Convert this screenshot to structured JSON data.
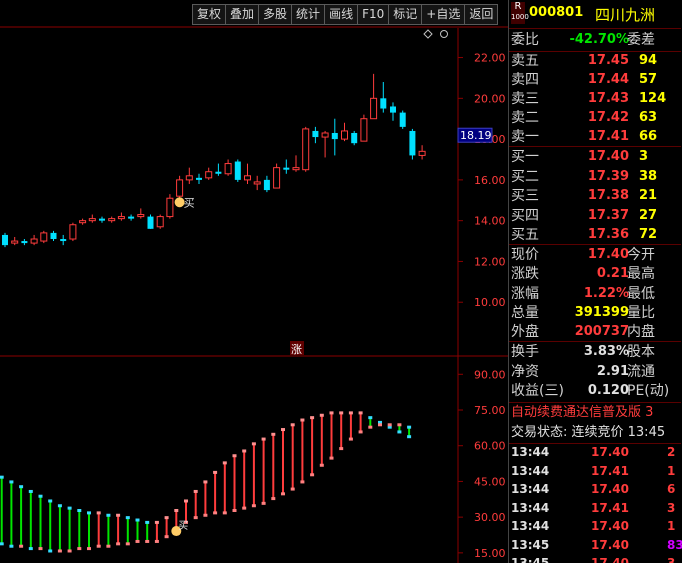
{
  "toolbar": {
    "buttons": [
      "复权",
      "叠加",
      "多股",
      "统计",
      "画线",
      "F10",
      "标记",
      "+自选",
      "返回"
    ]
  },
  "main_chart": {
    "y_ticks": [
      "22.00",
      "20.00",
      "18.00",
      "16.00",
      "14.00",
      "12.00",
      "10.00"
    ],
    "y_tick_values": [
      22,
      20,
      18,
      16,
      14,
      12,
      10
    ],
    "y_range": [
      8.0,
      23.4
    ],
    "current_price_tag": "18.19",
    "current_price_value": 18.19,
    "buy_signal": "买",
    "zhang_marker": "涨",
    "colors": {
      "up": "#ff3c3c",
      "down": "#00e0ff",
      "flat": "#ffffff"
    }
  },
  "chart_data": [
    {
      "type": "candlestick",
      "title": "",
      "ylim": [
        8.0,
        23.4
      ],
      "y_ticks": [
        22,
        20,
        18,
        16,
        14,
        12,
        10
      ],
      "candles": [
        {
          "o": 13.3,
          "c": 12.8,
          "h": 13.4,
          "l": 12.7
        },
        {
          "o": 12.9,
          "c": 13.0,
          "h": 13.2,
          "l": 12.8
        },
        {
          "o": 13.0,
          "c": 12.9,
          "h": 13.1,
          "l": 12.8
        },
        {
          "o": 12.9,
          "c": 13.1,
          "h": 13.3,
          "l": 12.8
        },
        {
          "o": 13.0,
          "c": 13.4,
          "h": 13.5,
          "l": 12.9
        },
        {
          "o": 13.4,
          "c": 13.1,
          "h": 13.5,
          "l": 13.0
        },
        {
          "o": 13.1,
          "c": 13.0,
          "h": 13.3,
          "l": 12.8
        },
        {
          "o": 13.1,
          "c": 13.8,
          "h": 13.9,
          "l": 13.0
        },
        {
          "o": 13.9,
          "c": 14.0,
          "h": 14.1,
          "l": 13.8
        },
        {
          "o": 14.0,
          "c": 14.1,
          "h": 14.3,
          "l": 13.9
        },
        {
          "o": 14.1,
          "c": 14.0,
          "h": 14.2,
          "l": 13.9
        },
        {
          "o": 14.0,
          "c": 14.1,
          "h": 14.2,
          "l": 13.9
        },
        {
          "o": 14.1,
          "c": 14.2,
          "h": 14.4,
          "l": 14.0
        },
        {
          "o": 14.2,
          "c": 14.1,
          "h": 14.3,
          "l": 14.0
        },
        {
          "o": 14.2,
          "c": 14.3,
          "h": 14.6,
          "l": 14.1
        },
        {
          "o": 14.2,
          "c": 13.6,
          "h": 14.3,
          "l": 13.6
        },
        {
          "o": 13.7,
          "c": 14.2,
          "h": 14.3,
          "l": 13.6
        },
        {
          "o": 14.2,
          "c": 15.1,
          "h": 15.3,
          "l": 14.1
        },
        {
          "o": 15.2,
          "c": 16.0,
          "h": 16.2,
          "l": 15.0
        },
        {
          "o": 16.0,
          "c": 16.2,
          "h": 16.6,
          "l": 15.8
        },
        {
          "o": 16.1,
          "c": 16.0,
          "h": 16.3,
          "l": 15.8
        },
        {
          "o": 16.1,
          "c": 16.4,
          "h": 16.6,
          "l": 16.0
        },
        {
          "o": 16.4,
          "c": 16.3,
          "h": 16.8,
          "l": 16.2
        },
        {
          "o": 16.3,
          "c": 16.8,
          "h": 17.0,
          "l": 16.2
        },
        {
          "o": 16.9,
          "c": 16.0,
          "h": 17.0,
          "l": 15.9
        },
        {
          "o": 16.0,
          "c": 16.2,
          "h": 16.8,
          "l": 15.8
        },
        {
          "o": 15.8,
          "c": 15.9,
          "h": 16.2,
          "l": 15.5
        },
        {
          "o": 16.0,
          "c": 15.5,
          "h": 16.2,
          "l": 15.4
        },
        {
          "o": 15.6,
          "c": 16.6,
          "h": 16.8,
          "l": 15.6
        },
        {
          "o": 16.6,
          "c": 16.5,
          "h": 17.0,
          "l": 16.3
        },
        {
          "o": 16.5,
          "c": 16.6,
          "h": 17.2,
          "l": 16.4
        },
        {
          "o": 16.5,
          "c": 18.5,
          "h": 18.6,
          "l": 16.4
        },
        {
          "o": 18.4,
          "c": 18.1,
          "h": 18.6,
          "l": 17.8
        },
        {
          "o": 18.1,
          "c": 18.3,
          "h": 18.4,
          "l": 17.1
        },
        {
          "o": 18.3,
          "c": 18.0,
          "h": 19.0,
          "l": 17.2
        },
        {
          "o": 18.0,
          "c": 18.4,
          "h": 18.8,
          "l": 17.9
        },
        {
          "o": 18.3,
          "c": 17.8,
          "h": 18.4,
          "l": 17.7
        },
        {
          "o": 17.9,
          "c": 19.0,
          "h": 19.2,
          "l": 17.9
        },
        {
          "o": 19.0,
          "c": 20.0,
          "h": 21.2,
          "l": 19.0
        },
        {
          "o": 20.0,
          "c": 19.5,
          "h": 20.8,
          "l": 19.3
        },
        {
          "o": 19.6,
          "c": 19.3,
          "h": 19.8,
          "l": 18.9
        },
        {
          "o": 19.3,
          "c": 18.6,
          "h": 19.4,
          "l": 18.5
        },
        {
          "o": 18.4,
          "c": 17.2,
          "h": 18.5,
          "l": 17.0
        },
        {
          "o": 17.2,
          "c": 17.4,
          "h": 17.7,
          "l": 17.0
        }
      ]
    },
    {
      "type": "bar",
      "title": "",
      "ylim": [
        12.0,
        96.0
      ],
      "y_ticks_labels": [
        "90.00",
        "75.00",
        "60.00",
        "45.00",
        "30.00",
        "15.00"
      ],
      "y_ticks": [
        90,
        75,
        60,
        45,
        30,
        15
      ],
      "main_values": [
        49,
        47,
        45,
        43,
        41,
        39,
        37,
        35,
        34,
        33,
        32,
        32,
        31,
        31,
        30,
        29,
        28,
        28,
        30,
        33,
        37,
        41,
        45,
        49,
        53,
        56,
        58,
        61,
        63,
        65,
        67,
        69,
        71,
        72,
        73,
        74,
        74,
        74,
        74,
        72,
        70,
        68,
        66,
        64
      ],
      "base_values": [
        20,
        19,
        18,
        18,
        17,
        17,
        16,
        16,
        16,
        17,
        17,
        18,
        18,
        19,
        19,
        20,
        20,
        20,
        22,
        25,
        28,
        30,
        31,
        32,
        32,
        33,
        34,
        35,
        36,
        38,
        40,
        42,
        45,
        48,
        52,
        55,
        59,
        63,
        66,
        68,
        69,
        69,
        69,
        68
      ],
      "colors": {
        "rising": "#ff3c3c",
        "falling": "#00e600",
        "base_rising": "#ff8080",
        "base_falling": "#33ddff"
      }
    }
  ],
  "lower_chart": {
    "y_ticks": [
      "90.00",
      "75.00",
      "60.00",
      "45.00",
      "30.00",
      "15.00"
    ],
    "y_tick_values": [
      90,
      75,
      60,
      45,
      30,
      15
    ],
    "signal": "买"
  },
  "quote": {
    "code": "000801",
    "name": "四川九洲",
    "badge_top": "R",
    "badge_bottom": "1000",
    "commission_ratio": {
      "label": "委比",
      "value": "-42.70%",
      "diff_label": "委差"
    },
    "asks": [
      {
        "label": "卖五",
        "price": "17.45",
        "vol": "94"
      },
      {
        "label": "卖四",
        "price": "17.44",
        "vol": "57"
      },
      {
        "label": "卖三",
        "price": "17.43",
        "vol": "124"
      },
      {
        "label": "卖二",
        "price": "17.42",
        "vol": "63"
      },
      {
        "label": "卖一",
        "price": "17.41",
        "vol": "66"
      }
    ],
    "bids": [
      {
        "label": "买一",
        "price": "17.40",
        "vol": "3"
      },
      {
        "label": "买二",
        "price": "17.39",
        "vol": "38"
      },
      {
        "label": "买三",
        "price": "17.38",
        "vol": "21"
      },
      {
        "label": "买四",
        "price": "17.37",
        "vol": "27"
      },
      {
        "label": "买五",
        "price": "17.36",
        "vol": "72"
      }
    ],
    "stats": [
      {
        "label": "现价",
        "value": "17.40",
        "label2": "今开",
        "color": "red"
      },
      {
        "label": "涨跌",
        "value": "0.21",
        "label2": "最高",
        "color": "red"
      },
      {
        "label": "涨幅",
        "value": "1.22%",
        "label2": "最低",
        "color": "red"
      },
      {
        "label": "总量",
        "value": "391399",
        "label2": "量比",
        "color": "yellow"
      },
      {
        "label": "外盘",
        "value": "200737",
        "label2": "内盘",
        "color": "red"
      }
    ],
    "stats2": [
      {
        "label": "换手",
        "value": "3.83%",
        "label2": "股本"
      },
      {
        "label": "净资",
        "value": "2.91",
        "label2": "流通"
      },
      {
        "label": "收益(三)",
        "value": "0.120",
        "label2": "PE(动)"
      }
    ],
    "ticker": "自动续费通达信普及版 3",
    "status": "交易状态: 连续竞价 13:45",
    "trades": [
      {
        "time": "13:44",
        "price": "17.40",
        "vol": "2",
        "color": "red"
      },
      {
        "time": "13:44",
        "price": "17.41",
        "vol": "1",
        "color": "red"
      },
      {
        "time": "13:44",
        "price": "17.40",
        "vol": "6",
        "color": "red"
      },
      {
        "time": "13:44",
        "price": "17.41",
        "vol": "3",
        "color": "red"
      },
      {
        "time": "13:44",
        "price": "17.40",
        "vol": "1",
        "color": "red"
      },
      {
        "time": "13:45",
        "price": "17.40",
        "vol": "83",
        "color": "purple"
      },
      {
        "time": "13:45",
        "price": "17.40",
        "vol": "3",
        "color": "red"
      }
    ]
  }
}
